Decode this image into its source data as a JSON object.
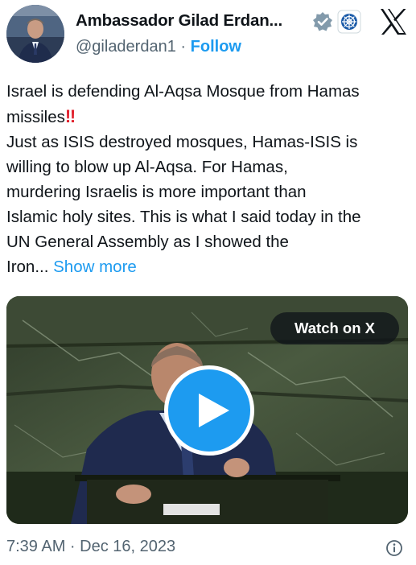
{
  "author": {
    "name": "Ambassador Gilad Erdan...",
    "handle": "@giladerdan1",
    "separator": "·",
    "follow_label": "Follow",
    "avatar_icon": "profile-photo",
    "verified_icon": "verified-badge-grey",
    "affiliation_icon": "un-emblem-badge"
  },
  "brand": {
    "logo_icon": "x-logo"
  },
  "tweet": {
    "lines": [
      "Israel is defending Al-Aqsa Mosque from Hamas",
      "missiles",
      "Just as ISIS destroyed mosques, Hamas-ISIS is",
      "willing to blow up Al-Aqsa. For Hamas,",
      "murdering Israelis is more important than",
      "Islamic holy sites. This is what I said today in the",
      "UN General Assembly as I showed the",
      "Iron..."
    ],
    "emoji": "‼",
    "show_more_label": "Show more"
  },
  "media": {
    "watch_label": "Watch on X",
    "play_icon": "play-icon"
  },
  "meta": {
    "timestamp": "7:39 AM · Dec 16, 2023",
    "info_icon": "info-icon"
  },
  "colors": {
    "accent": "#1d9bf0",
    "text": "#0f1419",
    "secondary": "#536471",
    "emoji_red": "#e1222e"
  }
}
